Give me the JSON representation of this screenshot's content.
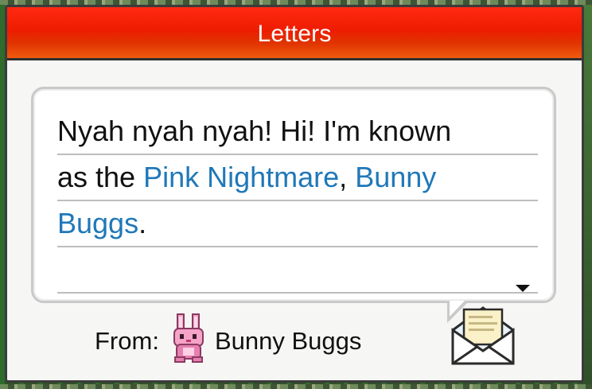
{
  "window": {
    "title": "Letters"
  },
  "letter": {
    "line1": "Nyah nyah nyah! Hi! I'm known",
    "line2_prefix": "as the ",
    "line2_name1": "Pink Nightmare",
    "line2_sep": ", ",
    "line2_name2": "Bunny",
    "line3_name2_rest": "Buggs",
    "line3_end": ".",
    "highlight_color": "#1f78b8"
  },
  "sender": {
    "prefix": "From:",
    "name": "Bunny Buggs",
    "avatar_icon": "pink-bunny-icon"
  },
  "icons": {
    "more": "down-triangle-icon",
    "envelope": "open-envelope-icon"
  },
  "colors": {
    "titlebar": "#ee1c00",
    "window_bg": "#f6f6f4"
  }
}
